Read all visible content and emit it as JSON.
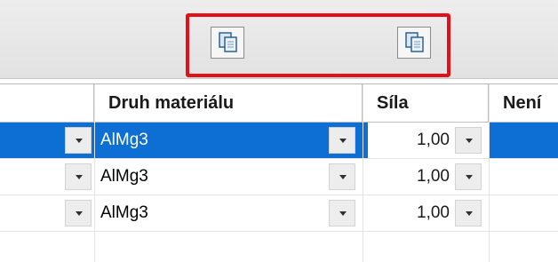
{
  "toolbar": {
    "buttons": [
      {
        "icon": "copy-pages-icon"
      },
      {
        "icon": "copy-pages-icon"
      }
    ],
    "highlight_color": "#e3101a"
  },
  "grid": {
    "columns": [
      "Druh materiálu",
      "Síla",
      "Není"
    ],
    "rows": [
      {
        "material": "AlMg3",
        "sila": "1,00",
        "selected": true
      },
      {
        "material": "AlMg3",
        "sila": "1,00",
        "selected": false
      },
      {
        "material": "AlMg3",
        "sila": "1,00",
        "selected": false
      }
    ],
    "selection_color": "#0d6fd4"
  }
}
